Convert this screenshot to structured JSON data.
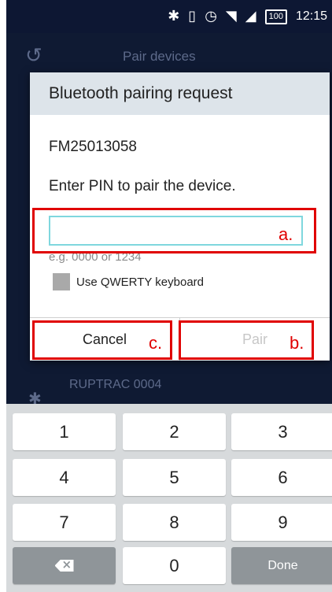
{
  "status_bar": {
    "icons": [
      "bluetooth-icon",
      "vibrate-icon",
      "alarm-icon",
      "wifi-icon",
      "signal-icon"
    ],
    "bluetooth_glyph": "✱",
    "vibrate_glyph": "▯",
    "alarm_glyph": "◷",
    "wifi_glyph": "◥",
    "signal_glyph": "◢",
    "battery": "100",
    "time": "12:15"
  },
  "background_app": {
    "refresh_glyph": "↺",
    "title": "Pair devices",
    "device_glyph": "✱",
    "device_name": "RUPTRAC 0004"
  },
  "dialog": {
    "title": "Bluetooth pairing request",
    "device_id": "FM25013058",
    "prompt": "Enter PIN to pair the device.",
    "pin_value": "",
    "pin_hint": "e.g. 0000 or 1234",
    "qwerty_label": "Use QWERTY keyboard",
    "qwerty_checked": false,
    "cancel_label": "Cancel",
    "pair_label": "Pair",
    "pair_enabled": false
  },
  "annotations": {
    "a": "a.",
    "b": "b.",
    "c": "c."
  },
  "annotation_color": "#e00000",
  "keypad": {
    "keys": [
      "1",
      "2",
      "3",
      "4",
      "5",
      "6",
      "7",
      "8",
      "9",
      "0"
    ],
    "done_label": "Done",
    "backspace_icon": "backspace-icon"
  }
}
